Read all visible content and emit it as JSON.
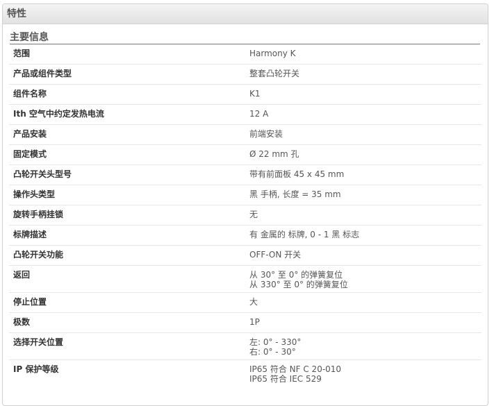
{
  "panel": {
    "title": "特性"
  },
  "section": {
    "title": "主要信息"
  },
  "rows": [
    {
      "label": "范围",
      "values": [
        "Harmony K"
      ]
    },
    {
      "label": "产品或组件类型",
      "values": [
        "整套凸轮开关"
      ]
    },
    {
      "label": "组件名称",
      "values": [
        "K1"
      ]
    },
    {
      "label": "Ith 空气中约定发热电流",
      "values": [
        "12 A"
      ]
    },
    {
      "label": "产品安装",
      "values": [
        "前端安装"
      ]
    },
    {
      "label": "固定模式",
      "values": [
        "Ø 22 mm 孔"
      ]
    },
    {
      "label": "凸轮开关头型号",
      "values": [
        "带有前面板 45 x 45 mm"
      ]
    },
    {
      "label": "操作头类型",
      "values": [
        "黑 手柄, 长度 = 35 mm"
      ]
    },
    {
      "label": "旋转手柄挂锁",
      "values": [
        "无"
      ]
    },
    {
      "label": "标牌描述",
      "values": [
        "有 金属的 标牌, 0 - 1 黑 标志"
      ]
    },
    {
      "label": "凸轮开关功能",
      "values": [
        "OFF-ON 开关"
      ]
    },
    {
      "label": "返回",
      "values": [
        "从 30° 至 0° 的弹簧复位",
        "从 330° 至 0° 的弹簧复位"
      ]
    },
    {
      "label": "停止位置",
      "values": [
        "大"
      ]
    },
    {
      "label": "极数",
      "values": [
        "1P"
      ]
    },
    {
      "label": "选择开关位置",
      "values": [
        "左: 0° - 330°",
        "右:   0° - 30°"
      ]
    },
    {
      "label": "IP 保护等级",
      "values": [
        "IP65 符合 NF C 20-010",
        "IP65 符合 IEC 529"
      ]
    }
  ]
}
